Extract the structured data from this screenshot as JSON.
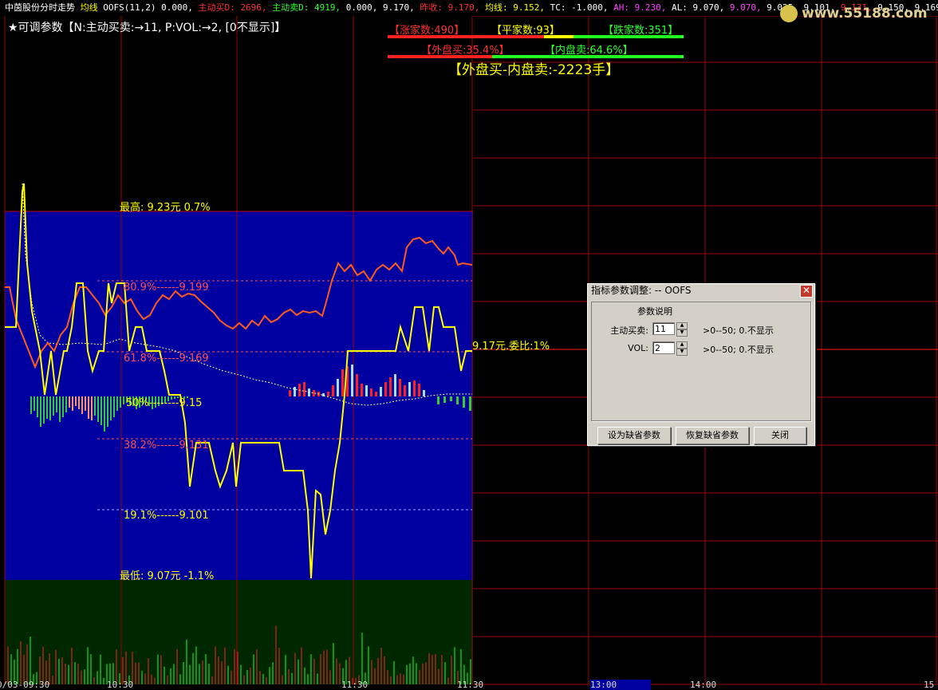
{
  "topbar": [
    {
      "text": "中茵股份分时走势",
      "color": "#ffffff"
    },
    {
      "text": " 均线 ",
      "color": "#ffff00"
    },
    {
      "text": "OOFS(11,2) ",
      "color": "#ffffff"
    },
    {
      "text": "0.000, ",
      "color": "#ffffff"
    },
    {
      "text": "主动买D: 2696, ",
      "color": "#ff3030"
    },
    {
      "text": "主动卖D: 4919, ",
      "color": "#30ff30"
    },
    {
      "text": "0.000, 9.170, ",
      "color": "#ffffff"
    },
    {
      "text": "昨收: 9.170, ",
      "color": "#ff3030"
    },
    {
      "text": "均线: 9.152, ",
      "color": "#ffff00"
    },
    {
      "text": "TC: -1.000, ",
      "color": "#ffffff"
    },
    {
      "text": "AH: 9.230, ",
      "color": "#ff40ff"
    },
    {
      "text": "AL: 9.070, ",
      "color": "#ffffff"
    },
    {
      "text": "9.070, ",
      "color": "#ff40ff"
    },
    {
      "text": "9.025, 9.101, ",
      "color": "#ffffff"
    },
    {
      "text": "9.131, ",
      "color": "#ff3030"
    },
    {
      "text": "9.150, 9.169, ",
      "color": "#ffffff"
    },
    {
      "text": "9.199, ",
      "color": "#ff40ff"
    },
    {
      "text": "0.000, ",
      "color": "#ffffff"
    },
    {
      "text": "买卖",
      "color": "#ffffff"
    }
  ],
  "watermark": "www.55188.com",
  "params_line": "★可调参数【N:主动买卖:→11,  P:VOL:→2, [0不显示]】",
  "stats": {
    "up_count": "【涨家数:490】",
    "flat_count": "【平家数:93】",
    "down_count": "【跌家数:351】",
    "outer_buy": "【外盘买:35.4%】",
    "inner_sell": "【内盘卖:64.6%】",
    "diff": "【外盘买-内盘卖:-2223手】"
  },
  "levels": {
    "high": "最高: 9.23元  0.7%",
    "l809": "80.9%------9.199",
    "l618": "61.8%------9.169",
    "l50": "50%--------9.15",
    "l382": "38.2%------9.131",
    "l191": "19.1%------9.101",
    "low": "最低: 9.07元  -1.1%",
    "current": "9.17元.委比:1%"
  },
  "time_axis": [
    "0/03-09:30",
    "10:30",
    "11:30",
    "11:30",
    "13:00",
    "14:00",
    "15"
  ],
  "colors": {
    "red_grid": "#a00000",
    "blue_panel": "#0000a0",
    "green_panel": "#002800",
    "price_line": "#ffff00",
    "orange_line": "#ff5a1e",
    "up": "#ff2020",
    "down": "#20ff20"
  },
  "dialog": {
    "title": "指标参数调整: -- OOFS",
    "section": "参数说明",
    "rows": [
      {
        "label": "主动买卖:",
        "value": "11",
        "range": ">0--50; 0.不显示"
      },
      {
        "label": "VOL:",
        "value": "2",
        "range": ">0--50; 0.不显示"
      }
    ],
    "buttons": {
      "set_default": "设为缺省参数",
      "restore_default": "恢复缺省参数",
      "close": "关闭"
    },
    "close_icon": "close-icon"
  }
}
